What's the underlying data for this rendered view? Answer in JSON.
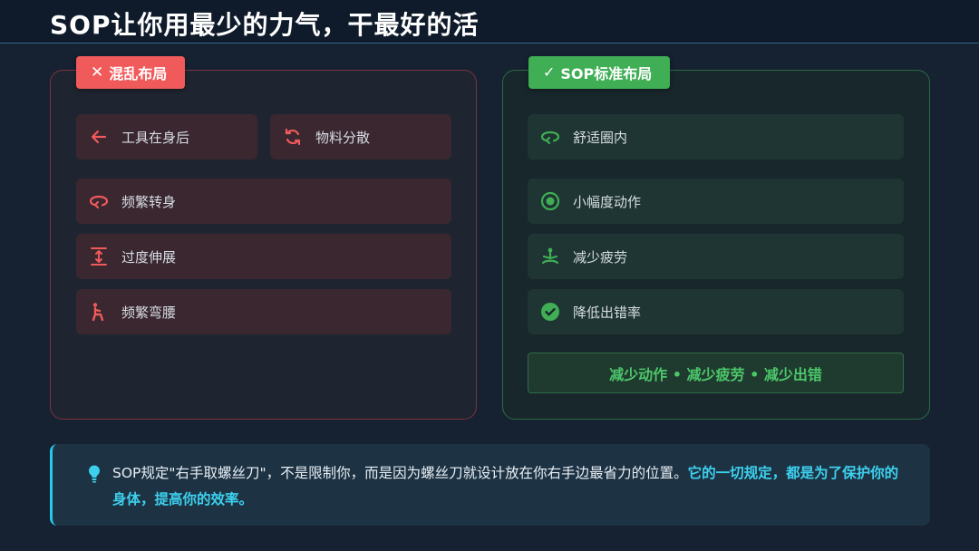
{
  "title": "SOP让你用最少的力气，干最好的活",
  "bad_panel": {
    "badge": "混乱布局",
    "items": [
      {
        "label": "工具在身后",
        "icon": "arrow-left-icon"
      },
      {
        "label": "物料分散",
        "icon": "sync-icon"
      },
      {
        "label": "频繁转身",
        "icon": "turn-around-icon"
      },
      {
        "label": "过度伸展",
        "icon": "stretch-vertical-icon"
      },
      {
        "label": "频繁弯腰",
        "icon": "bending-person-icon"
      }
    ]
  },
  "good_panel": {
    "badge": "SOP标准布局",
    "items": [
      {
        "label": "舒适圈内",
        "icon": "turn-around-icon"
      },
      {
        "label": "小幅度动作",
        "icon": "target-dot-icon"
      },
      {
        "label": "减少疲劳",
        "icon": "meditation-icon"
      },
      {
        "label": "降低出错率",
        "icon": "check-circle-icon"
      }
    ],
    "summary": "减少动作 • 减少疲劳 • 减少出错"
  },
  "note": {
    "icon": "lightbulb-icon",
    "text": "SOP规定\"右手取螺丝刀\"，不是限制你，而是因为螺丝刀就设计放在你右手边最省力的位置。",
    "highlight": "它的一切规定，都是为了保护你的身体，提高你的效率。"
  },
  "colors": {
    "bad": "#f05a5a",
    "good": "#3fae54",
    "accent": "#28c8e8"
  }
}
